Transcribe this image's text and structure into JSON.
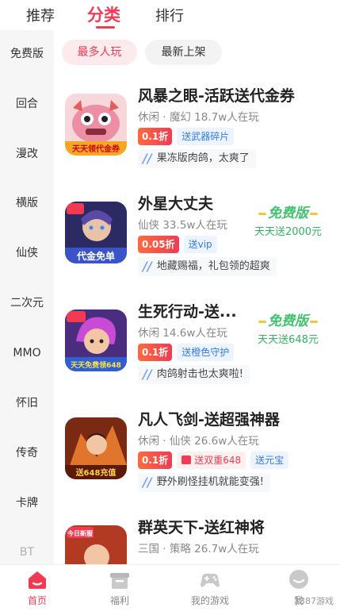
{
  "top_tabs": [
    "推荐",
    "分类",
    "排行"
  ],
  "sidebar": [
    "免费版",
    "回合",
    "漫改",
    "横版",
    "仙侠",
    "二次元",
    "MMO",
    "怀旧",
    "传奇",
    "卡牌",
    "BT"
  ],
  "filters": {
    "active": "最多人玩",
    "inactive": "最新上架"
  },
  "games": [
    {
      "title": "风暴之眼-活跃送代金券",
      "meta": "休闲 · 魔幻  18.7w人在玩",
      "discount": "0.1折",
      "tags": [
        "送武器碎片"
      ],
      "note": "果冻版肉鸽，太爽了",
      "icon_text": "天天领代金券",
      "badge_label": "",
      "badge_sub": ""
    },
    {
      "title": "外星大丈夫",
      "meta": "仙侠  33.5w人在玩",
      "discount": "0.05折",
      "tags": [
        "送vip"
      ],
      "note": "地藏赐福，礼包领的超爽",
      "icon_text": "代金免单",
      "badge_label": "免费版",
      "badge_sub": "天天送2000元"
    },
    {
      "title": "生死行动-送...",
      "meta": "休闲  14.6w人在玩",
      "discount": "0.1折",
      "tags": [
        "送橙色守护"
      ],
      "note": "肉鸽射击也太爽啦!",
      "icon_text": "天天免费领648",
      "badge_label": "免费版",
      "badge_sub": "天天送648元"
    },
    {
      "title": "凡人飞剑-送超强神器",
      "meta": "休闲 · 仙侠  26.6w人在玩",
      "discount": "0.1折",
      "tags": [
        "送双重648",
        "送元宝"
      ],
      "note": "野外刷怪挂机就能变强!",
      "icon_text": "送648充值",
      "badge_label": "",
      "badge_sub": ""
    },
    {
      "title": "群英天下-送红神将",
      "meta": "三国 · 策略  26.7w人在玩",
      "discount": "",
      "tags": [],
      "note": "",
      "icon_text": "今日新服",
      "badge_label": "",
      "badge_sub": ""
    }
  ],
  "bottom_nav": [
    "首页",
    "福利",
    "我的游戏",
    "我"
  ],
  "watermark": "3387游戏",
  "colors": {
    "accent": "#f23b53",
    "tag_blue": "#2f7ce8",
    "free_green": "#42c16f"
  }
}
